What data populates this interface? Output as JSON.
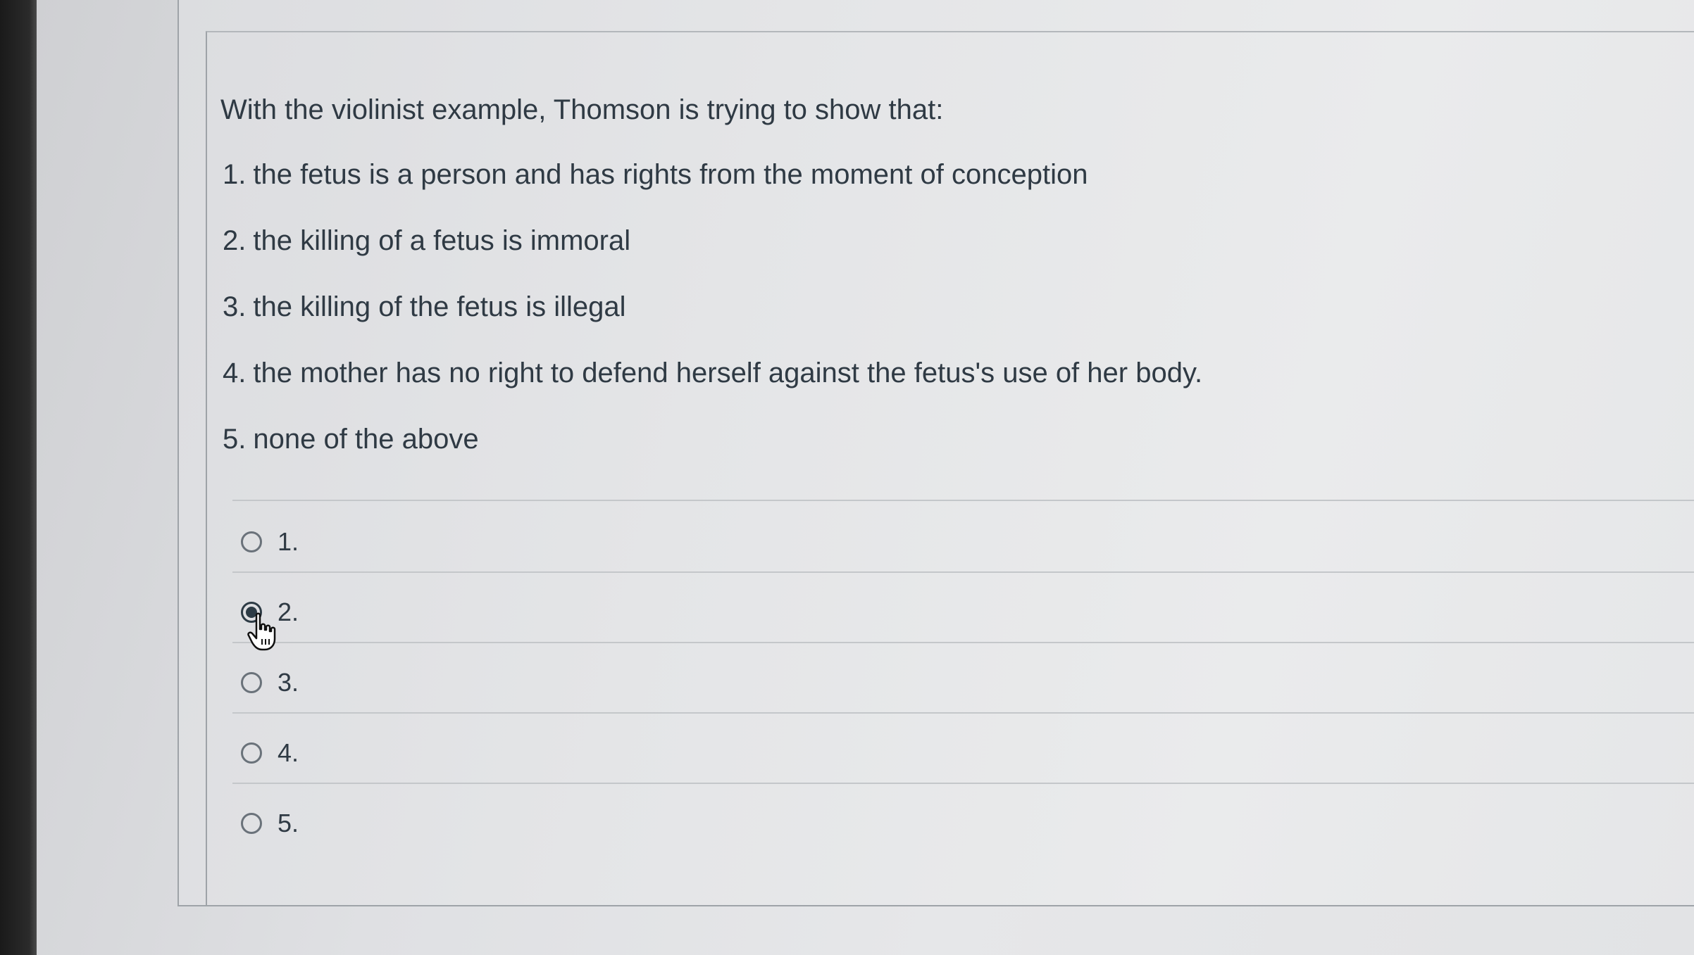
{
  "question": {
    "prompt": "With the violinist example, Thomson is trying to show that:",
    "statements": [
      {
        "num": "1.",
        "text": "the fetus is a person and has rights from the moment of conception"
      },
      {
        "num": "2.",
        "text": "the killing of a fetus is immoral"
      },
      {
        "num": "3.",
        "text": "the killing of the fetus is illegal"
      },
      {
        "num": "4.",
        "text": "the mother has no right to defend herself against the fetus's use of her body."
      },
      {
        "num": "5.",
        "text": "none of the above"
      }
    ]
  },
  "answers": {
    "options": [
      {
        "label": "1.",
        "selected": false
      },
      {
        "label": "2.",
        "selected": true
      },
      {
        "label": "3.",
        "selected": false
      },
      {
        "label": "4.",
        "selected": false
      },
      {
        "label": "5.",
        "selected": false
      }
    ]
  },
  "icons": {
    "cursor": "hand-pointer-icon",
    "radio": "radio-button-icon"
  },
  "colors": {
    "text": "#2f3a44",
    "radio_border": "#6a727a",
    "radio_fill": "#2d3b45",
    "divider": "#c4c7ca",
    "background": "#e6e7e9"
  }
}
